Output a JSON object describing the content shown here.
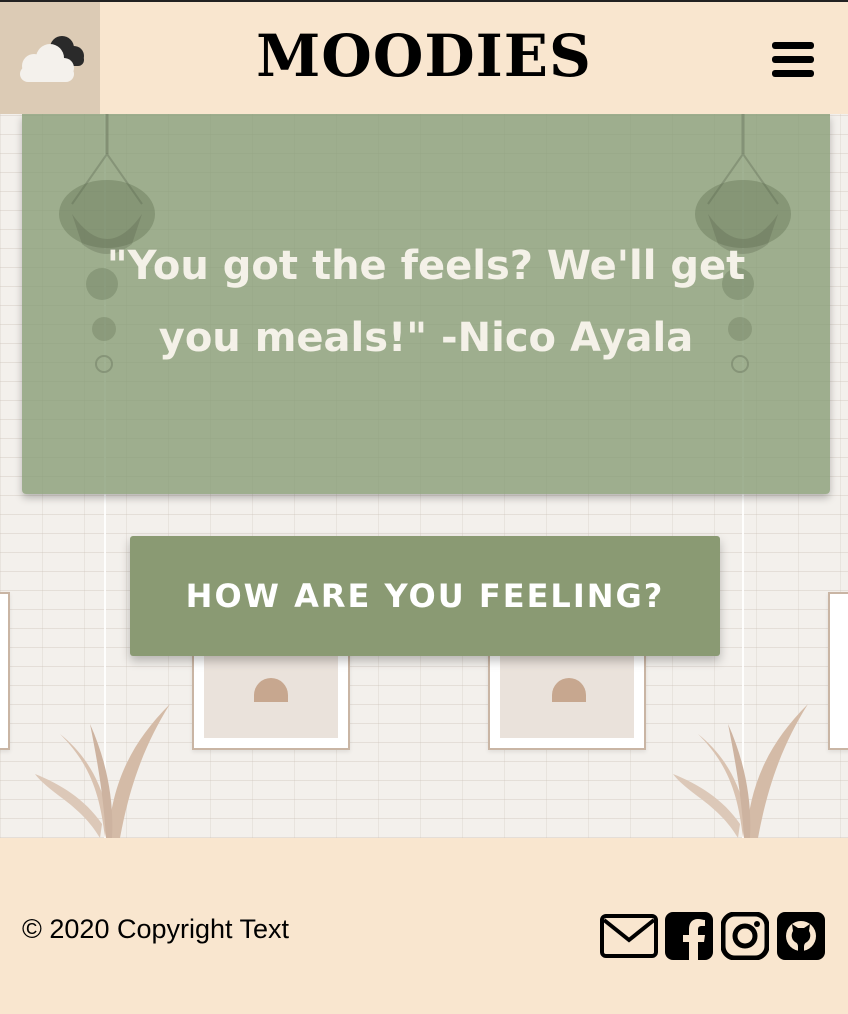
{
  "header": {
    "brand": "MOODIES",
    "logo_icon": "cloud-icon",
    "menu_icon": "hamburger-menu-icon"
  },
  "hero": {
    "quote": "\"You got the feels? We'll get you meals!\" -Nico Ayala",
    "cta_label": "HOW ARE YOU FEELING?"
  },
  "footer": {
    "copyright": "© 2020 Copyright Text",
    "social": [
      {
        "icon": "email-icon"
      },
      {
        "icon": "facebook-icon"
      },
      {
        "icon": "instagram-icon"
      },
      {
        "icon": "github-icon"
      }
    ]
  },
  "colors": {
    "header_bg": "#f9e6cf",
    "logo_bg": "#dccbb5",
    "quote_card": "#859b73",
    "cta": "#8a9a73",
    "footer_bg": "#f9e6cf"
  }
}
